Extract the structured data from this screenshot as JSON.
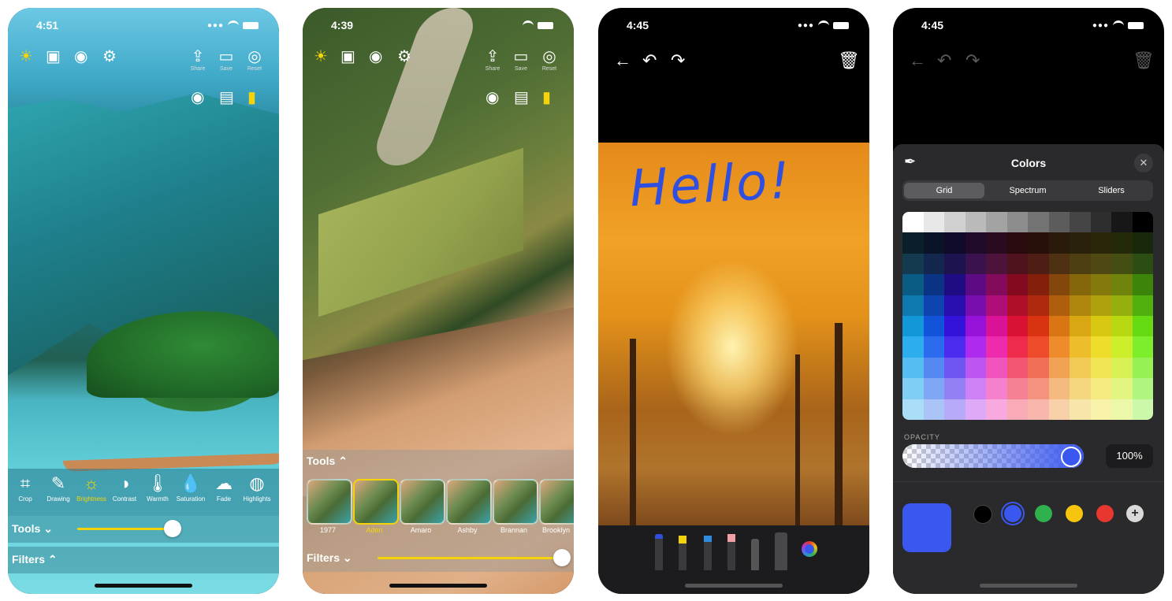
{
  "phones": [
    {
      "status_time": "4:51",
      "header_actions": [
        "Share",
        "Save",
        "Reset"
      ],
      "tools": [
        "Crop",
        "Drawing",
        "Brightness",
        "Contrast",
        "Warmth",
        "Saturation",
        "Fade",
        "Highlights"
      ],
      "active_tool": "Brightness",
      "tools_label": "Tools",
      "filters_label": "Filters",
      "slider_value": 0.62
    },
    {
      "status_time": "4:39",
      "header_actions": [
        "Share",
        "Save",
        "Reset"
      ],
      "tools_label": "Tools",
      "filters_label": "Filters",
      "filters": [
        "1977",
        "Aden",
        "Amaro",
        "Ashby",
        "Brannan",
        "Brooklyn"
      ],
      "selected_filter": "Aden",
      "slider_value": 1.0
    },
    {
      "status_time": "4:45",
      "drawing_text": "Hello!",
      "ink_color": "#2f4fe0"
    },
    {
      "status_time": "4:45",
      "sheet_title": "Colors",
      "tabs": [
        "Grid",
        "Spectrum",
        "Sliders"
      ],
      "active_tab": "Grid",
      "opacity_label": "OPACITY",
      "opacity_value": "100%",
      "selected_color": "#3a58f0",
      "swatches": [
        "#000000",
        "#3a58f0",
        "#2fb24d",
        "#f5c60d",
        "#e8372f"
      ]
    }
  ],
  "colors": {
    "accent_yellow": "#f5d30a",
    "sheet_bg": "#2a2a2c"
  }
}
